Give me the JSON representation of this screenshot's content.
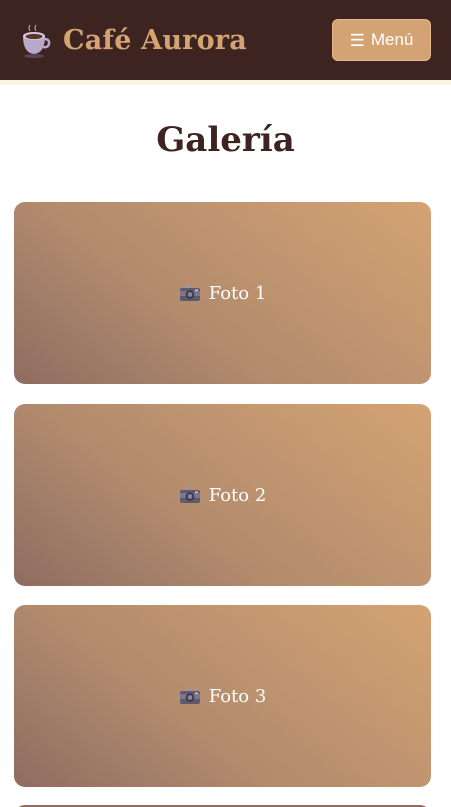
{
  "header": {
    "brand_name": "Café Aurora",
    "brand_icon": "coffee-cup-icon",
    "menu_icon": "hamburger-icon",
    "menu_glyph": "☰",
    "menu_label": "Menú"
  },
  "page": {
    "title": "Galería"
  },
  "gallery": {
    "card_icon": "camera-icon",
    "items": [
      {
        "label": "Foto 1"
      },
      {
        "label": "Foto 2"
      },
      {
        "label": "Foto 3"
      }
    ]
  },
  "colors": {
    "header_bg": "#3e2420",
    "accent": "#d4a373",
    "title": "#3e2420",
    "card_gradient_start": "#8f6c61",
    "card_gradient_end": "#d4a373"
  }
}
